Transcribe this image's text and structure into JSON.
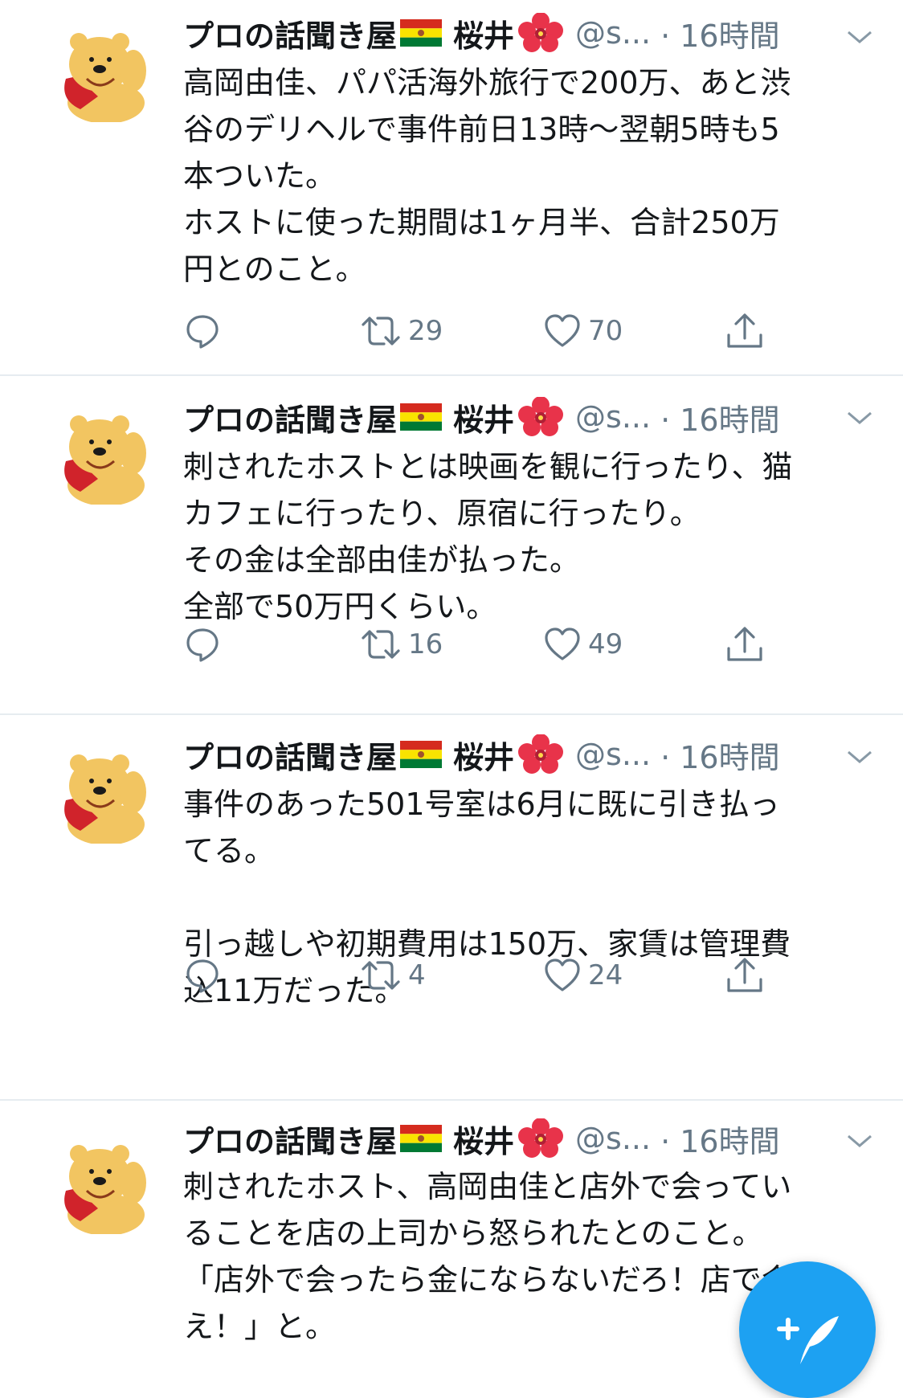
{
  "tweets": [
    {
      "author": "プロの話聞き屋",
      "author_suffix": "桜井",
      "handle": "@s...",
      "time": "· 16時間",
      "lines": [
        "高岡由佳、パパ活海外旅行で200万、あと渋",
        "谷のデリヘルで事件前日13時〜翌朝5時も5",
        "本ついた。",
        "ホストに使った期間は1ヶ月半、合計250万",
        "円とのこと。"
      ],
      "retweets": "29",
      "likes": "70"
    },
    {
      "author": "プロの話聞き屋",
      "author_suffix": "桜井",
      "handle": "@s...",
      "time": "· 16時間",
      "lines": [
        "刺されたホストとは映画を観に行ったり、猫",
        "カフェに行ったり、原宿に行ったり。",
        "その金は全部由佳が払った。",
        "全部で50万円くらい。"
      ],
      "retweets": "16",
      "likes": "49"
    },
    {
      "author": "プロの話聞き屋",
      "author_suffix": "桜井",
      "handle": "@s...",
      "time": "· 16時間",
      "lines": [
        "事件のあった501号室は6月に既に引き払っ",
        "てる。",
        "",
        "引っ越しや初期費用は150万、家賃は管理費",
        "込11万だった。"
      ],
      "retweets": "4",
      "likes": "24"
    },
    {
      "author": "プロの話聞き屋",
      "author_suffix": "桜井",
      "handle": "@s...",
      "time": "· 16時間",
      "lines": [
        "刺されたホスト、高岡由佳と店外で会ってい",
        "ることを店の上司から怒られたとのこと。",
        "「店外で会ったら金にならないだろ！店で会",
        "え！」と。"
      ]
    }
  ],
  "icons": {
    "avatar": "bear-avatar",
    "flag": "bolivia-flag-emoji",
    "flower": "hibiscus-emoji",
    "reply": "reply-icon",
    "retweet": "retweet-icon",
    "like": "heart-icon",
    "share": "share-icon",
    "caret": "chevron-down-icon",
    "compose": "compose-tweet-icon"
  },
  "colors": {
    "accent": "#1da1f2",
    "text": "#14171a",
    "secondary": "#657786",
    "divider": "#e6ecf0"
  }
}
